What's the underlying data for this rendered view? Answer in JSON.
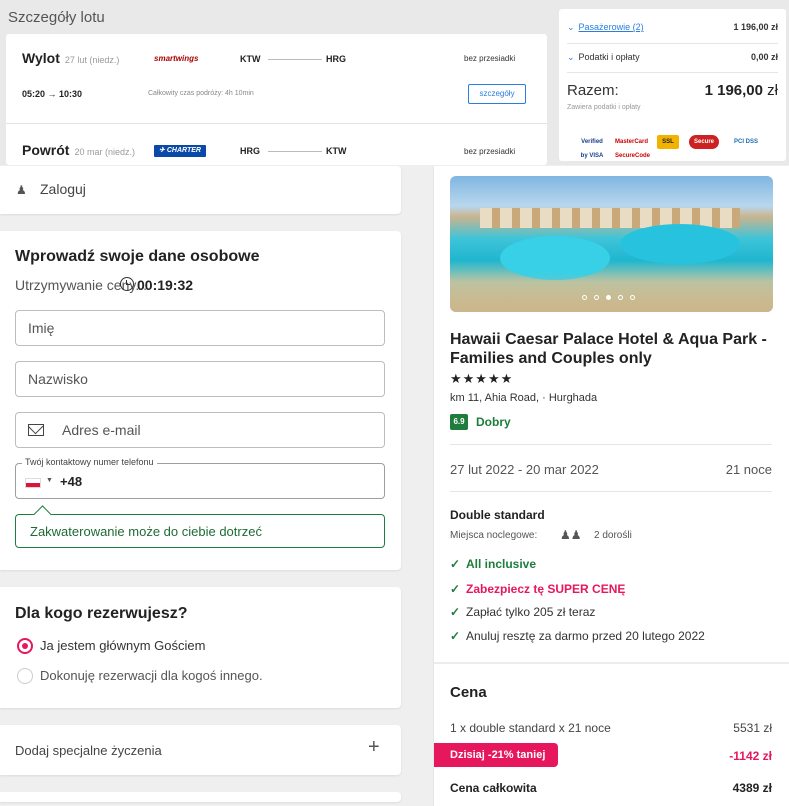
{
  "flight": {
    "section_title": "Szczegóły lotu",
    "outbound": {
      "label": "Wylot",
      "date": "27 lut (niedz.)",
      "airline": "smartwings",
      "from": "KTW",
      "to": "HRG",
      "stops": "bez przesiadki",
      "times": "05:20  →  10:30",
      "duration": "Całkowity czas podróży: 4h 10min",
      "details_button": "szczegóły"
    },
    "return": {
      "label": "Powrót",
      "date": "20 mar (niedz.)",
      "airline": "CHARTER",
      "from": "HRG",
      "to": "KTW",
      "stops": "bez przesiadki"
    }
  },
  "summary": {
    "passengers_label": "Pasażerowie (2)",
    "passengers_value": "1 196,00 zł",
    "taxes_label": "Podatki i opłaty",
    "taxes_value": "0,00 zł",
    "total_label": "Razem:",
    "total_value": "1 196,00",
    "total_currency": "zł",
    "includes": "Zawiera podatki i opłaty",
    "logos": [
      "Verified by VISA",
      "MasterCard SecureCode",
      "SSL",
      "Secure",
      "PCI DSS"
    ]
  },
  "login": {
    "label": "Zaloguj"
  },
  "personal": {
    "title": "Wprowadź swoje dane osobowe",
    "hold_label": "Utrzymywanie ceny...",
    "timer": "00:19:32",
    "first_name_placeholder": "Imię",
    "last_name_placeholder": "Nazwisko",
    "email_placeholder": "Adres e-mail",
    "phone_legend": "Twój kontaktowy numer telefonu",
    "phone_prefix": "+48",
    "tip": "Zakwaterowanie może do ciebie dotrzeć"
  },
  "booking_for": {
    "title": "Dla kogo rezerwujesz?",
    "option_self": "Ja jestem głównym Gościem",
    "option_other": "Dokonuję rezerwacji dla kogoś innego."
  },
  "special": {
    "label": "Dodaj specjalne życzenia",
    "plus": "+"
  },
  "hotel": {
    "name": "Hawaii Caesar Palace Hotel & Aqua Park - Families and Couples only",
    "stars": "★★★★★",
    "address": "km 11, Ahia Road, · Hurghada",
    "rating_score": "6.9",
    "rating_text": "Dobry",
    "dates": "27 lut 2022 - 20 mar 2022",
    "nights": "21 noce",
    "room": "Double standard",
    "places_label": "Miejsca noclegowe:",
    "adults": "2 dorośli",
    "features": [
      "All inclusive",
      "Zabezpiecz tę SUPER CENĘ",
      "Zapłać tylko 205 zł teraz",
      "Anuluj resztę za darmo przed 20 lutego 2022"
    ]
  },
  "price": {
    "title": "Cena",
    "line_label": "1 x double standard x 21 noce",
    "line_value": "5531 zł",
    "discount_label": "Dzisiaj -21% taniej",
    "discount_value": "-1142 zł",
    "total_label": "Cena całkowita",
    "total_value": "4389 zł"
  }
}
